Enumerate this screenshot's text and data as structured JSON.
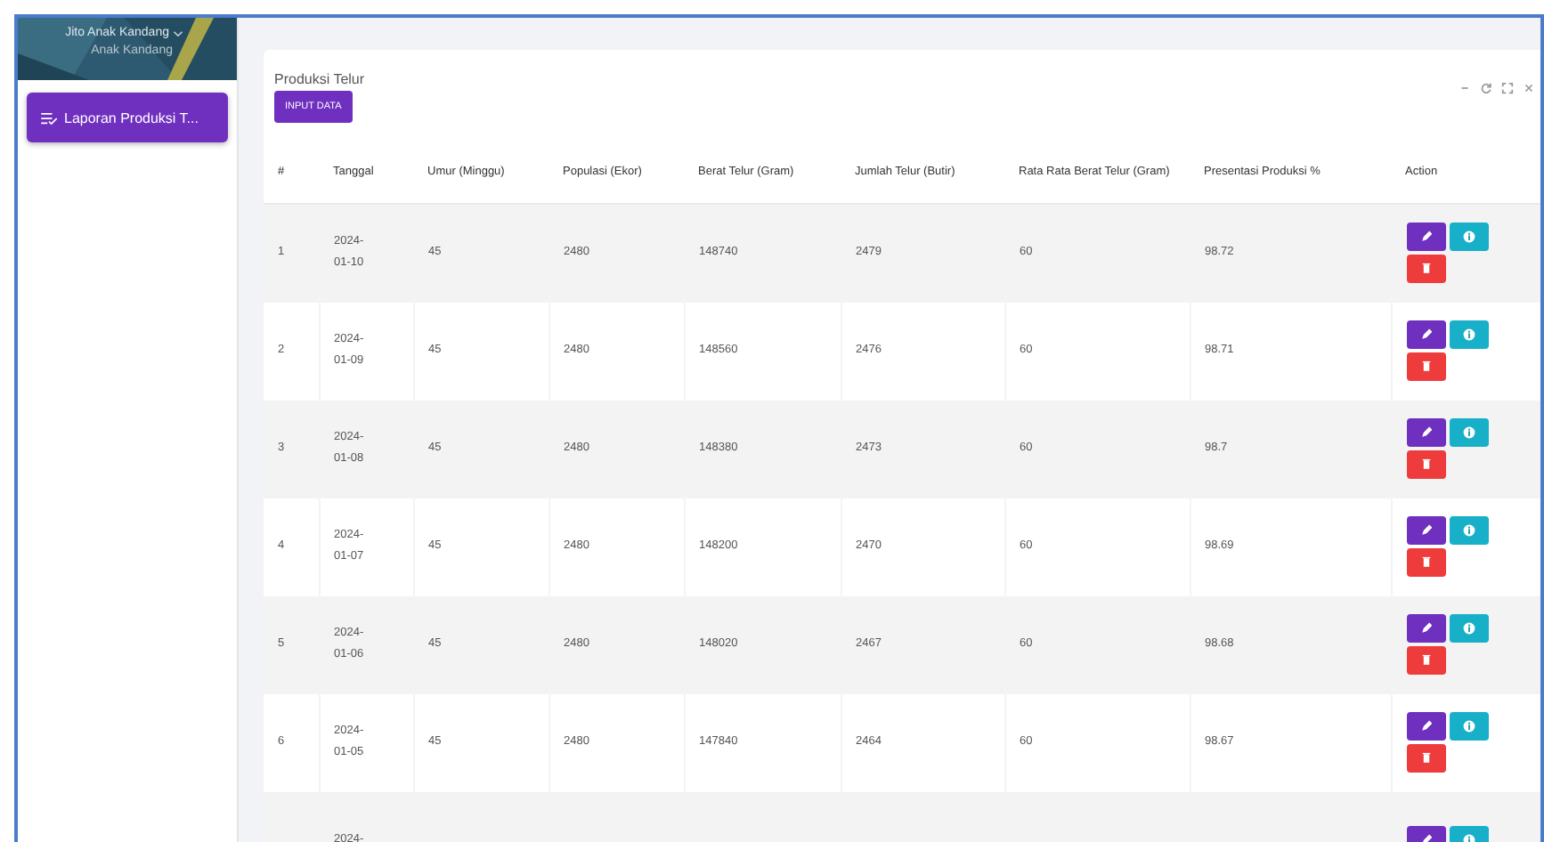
{
  "sidebar": {
    "user_name": "Jito Anak Kandang",
    "user_role": "Anak Kandang",
    "items": [
      {
        "label": "Laporan Produksi T...",
        "selected": true
      }
    ]
  },
  "card": {
    "title": "Produksi Telur",
    "add_button": "INPUT DATA"
  },
  "table": {
    "columns": [
      "#",
      "Tanggal",
      "Umur (Minggu)",
      "Populasi (Ekor)",
      "Berat Telur (Gram)",
      "Jumlah Telur (Butir)",
      "Rata Rata Berat Telur (Gram)",
      "Presentasi Produksi %",
      "Action"
    ],
    "rows": [
      {
        "cells": [
          "1",
          "2024-01-10",
          "45",
          "2480",
          "148740",
          "2479",
          "60",
          "98.72"
        ],
        "actions": [
          {
            "kind": "edit"
          },
          {
            "kind": "info"
          },
          {
            "kind": "delete"
          }
        ]
      },
      {
        "cells": [
          "2",
          "2024-01-09",
          "45",
          "2480",
          "148560",
          "2476",
          "60",
          "98.71"
        ],
        "actions": [
          {
            "kind": "edit"
          },
          {
            "kind": "info"
          },
          {
            "kind": "delete"
          }
        ]
      },
      {
        "cells": [
          "3",
          "2024-01-08",
          "45",
          "2480",
          "148380",
          "2473",
          "60",
          "98.7"
        ],
        "actions": [
          {
            "kind": "edit"
          },
          {
            "kind": "info"
          },
          {
            "kind": "delete"
          }
        ]
      },
      {
        "cells": [
          "4",
          "2024-01-07",
          "45",
          "2480",
          "148200",
          "2470",
          "60",
          "98.69"
        ],
        "actions": [
          {
            "kind": "edit"
          },
          {
            "kind": "info"
          },
          {
            "kind": "delete"
          }
        ]
      },
      {
        "cells": [
          "5",
          "2024-01-06",
          "45",
          "2480",
          "148020",
          "2467",
          "60",
          "98.68"
        ],
        "actions": [
          {
            "kind": "edit"
          },
          {
            "kind": "info"
          },
          {
            "kind": "delete"
          }
        ]
      },
      {
        "cells": [
          "6",
          "2024-01-05",
          "45",
          "2480",
          "147840",
          "2464",
          "60",
          "98.67"
        ],
        "actions": [
          {
            "kind": "edit"
          },
          {
            "kind": "info"
          },
          {
            "kind": "delete"
          }
        ]
      },
      {
        "cells": [
          "",
          "2024-",
          "",
          "",
          "",
          "",
          "",
          ""
        ],
        "actions": [
          {
            "kind": "edit"
          },
          {
            "kind": "info"
          }
        ]
      }
    ]
  }
}
